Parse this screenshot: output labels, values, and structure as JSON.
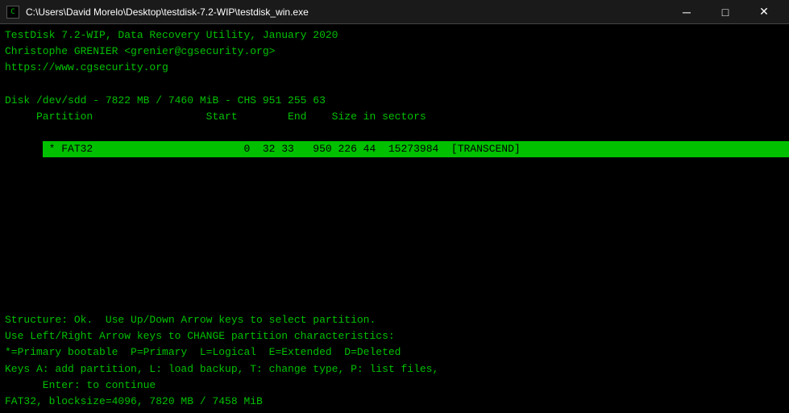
{
  "titlebar": {
    "path": "C:\\Users\\David Morelo\\Desktop\\testdisk-7.2-WIP\\testdisk_win.exe",
    "minimize_label": "─",
    "maximize_label": "□",
    "close_label": "✕"
  },
  "console": {
    "line1": "TestDisk 7.2-WIP, Data Recovery Utility, January 2020",
    "line2": "Christophe GRENIER <grenier@cgsecurity.org>",
    "line3": "https://www.cgsecurity.org",
    "line4": "",
    "line5": "Disk /dev/sdd - 7822 MB / 7460 MiB - CHS 951 255 63",
    "line6": "     Partition                  Start        End    Size in sectors",
    "partition_row": " * FAT32                        0  32 33   950 226 44  15273984  [TRANSCEND]",
    "footer1": "Structure: Ok.  Use Up/Down Arrow keys to select partition.",
    "footer2": "Use Left/Right Arrow keys to CHANGE partition characteristics:",
    "footer3": "*=Primary bootable  P=Primary  L=Logical  E=Extended  D=Deleted",
    "footer4": "Keys A: add partition, L: load backup, T: change type, P: list files,",
    "footer5": "      Enter: to continue",
    "footer6": "FAT32, blocksize=4096, 7820 MB / 7458 MiB"
  }
}
